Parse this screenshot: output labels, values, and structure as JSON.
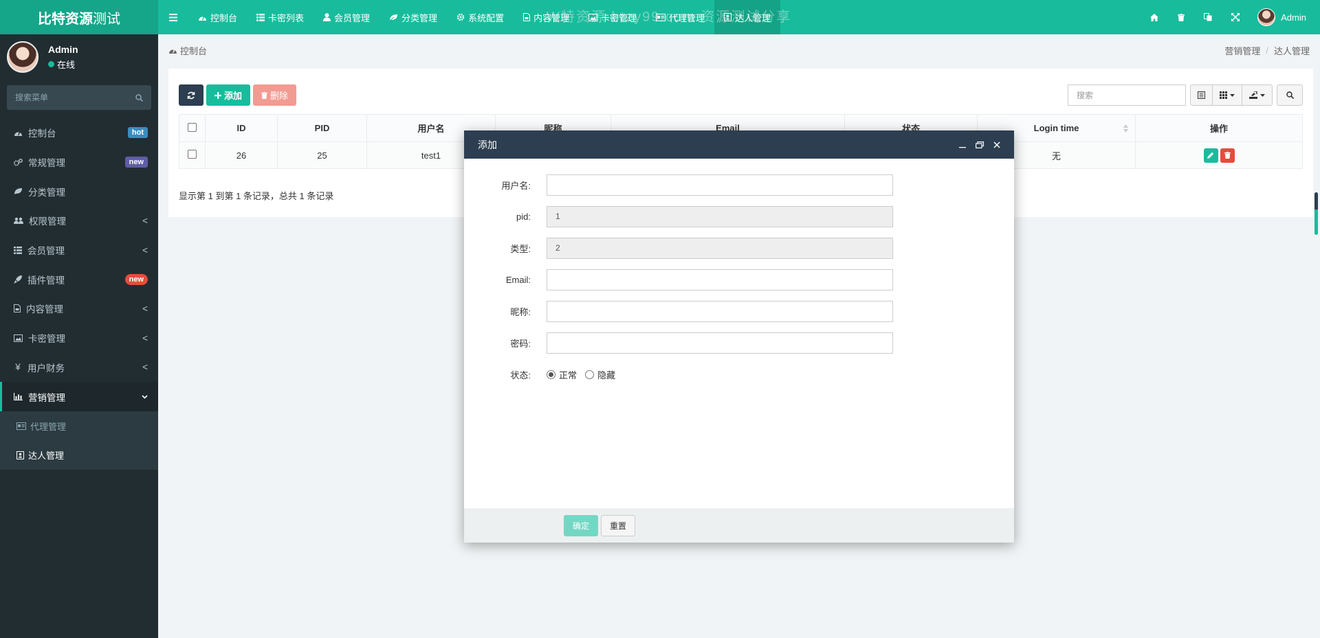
{
  "logo": {
    "bold": "比特资源",
    "normal": "测试"
  },
  "topnav": [
    {
      "icon": "dashboard-icon",
      "label": "控制台"
    },
    {
      "icon": "list-icon",
      "label": "卡密列表"
    },
    {
      "icon": "user-icon",
      "label": "会员管理"
    },
    {
      "icon": "leaf-icon",
      "label": "分类管理"
    },
    {
      "icon": "gear-icon",
      "label": "系统配置"
    },
    {
      "icon": "file-icon",
      "label": "内容管理"
    },
    {
      "icon": "image-icon",
      "label": "卡密管理"
    },
    {
      "icon": "id-card-icon",
      "label": "代理管理"
    },
    {
      "icon": "contact-book-icon",
      "label": "达人管理",
      "active": true
    }
  ],
  "watermark": "W特资源 btzy99.com 资源测试分享",
  "topright": {
    "user_name": "Admin"
  },
  "sidebar": {
    "user": {
      "name": "Admin",
      "status": "在线"
    },
    "search_placeholder": "搜索菜单",
    "items": [
      {
        "icon": "dashboard-icon",
        "label": "控制台",
        "badge": "hot"
      },
      {
        "icon": "cogs-icon",
        "label": "常规管理",
        "badge": "new"
      },
      {
        "icon": "leaf-icon",
        "label": "分类管理"
      },
      {
        "icon": "users-icon",
        "label": "权限管理",
        "arrow": "<"
      },
      {
        "icon": "list-icon",
        "label": "会员管理",
        "arrow": "<"
      },
      {
        "icon": "rocket-icon",
        "label": "插件管理",
        "badge": "new"
      },
      {
        "icon": "file-icon",
        "label": "内容管理",
        "arrow": "<"
      },
      {
        "icon": "image-icon",
        "label": "卡密管理",
        "arrow": "<"
      },
      {
        "icon": "yen-icon",
        "label": "用户财务",
        "arrow": "<"
      },
      {
        "icon": "bar-chart-icon",
        "label": "营销管理"
      }
    ],
    "submenu": [
      {
        "icon": "id-card-icon",
        "label": "代理管理"
      },
      {
        "icon": "contact-book-icon",
        "label": "达人管理"
      }
    ]
  },
  "breadcrumb": {
    "left": "控制台",
    "right": [
      "营销管理",
      "达人管理"
    ]
  },
  "toolbar": {
    "add": "添加",
    "delete": "删除",
    "search_placeholder": "搜索"
  },
  "table": {
    "headers": [
      "ID",
      "PID",
      "用户名",
      "昵称",
      "Email",
      "状态",
      "Login time",
      "操作"
    ],
    "rows": [
      {
        "id": "26",
        "pid": "25",
        "username": "test1",
        "login_time": "无"
      }
    ],
    "page_info": "显示第 1 到第 1 条记录，总共 1 条记录"
  },
  "modal": {
    "title": "添加",
    "fields": [
      {
        "label": "用户名:",
        "value": ""
      },
      {
        "label": "pid:",
        "value": "1"
      },
      {
        "label": "类型:",
        "value": "2"
      },
      {
        "label": "Email:",
        "value": ""
      },
      {
        "label": "昵称:",
        "value": ""
      },
      {
        "label": "密码:",
        "value": ""
      }
    ],
    "status_label": "状态:",
    "status_options": [
      "正常",
      "隐藏"
    ],
    "confirm": "确定",
    "reset": "重置"
  },
  "colors": {
    "primary": "#18bc9c",
    "dark": "#2c3e50",
    "sidebar": "#222d32",
    "danger": "#e74c3c"
  }
}
